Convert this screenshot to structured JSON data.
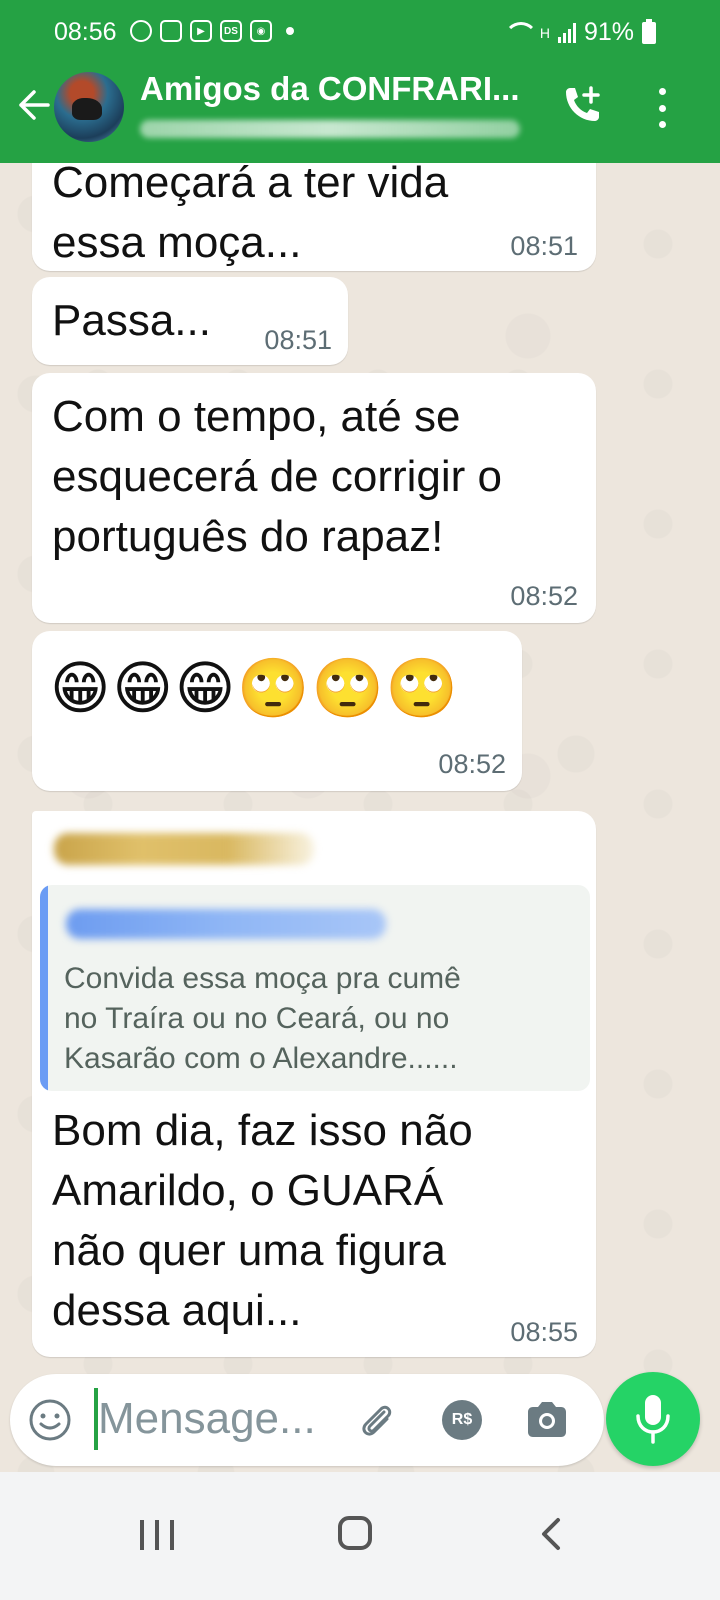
{
  "status_bar": {
    "time": "08:56",
    "battery": "91%",
    "network_indicator": "H",
    "app_icons": [
      "whatsapp-icon",
      "news-icon",
      "youtube-icon",
      "ds-icon",
      "camera-app-icon"
    ]
  },
  "header": {
    "title": "Amigos da CONFRARI...",
    "subtitle_redacted": true,
    "brand_color": "#25a244"
  },
  "messages": [
    {
      "text": "Começará a ter vida\nessa moça...",
      "time": "08:51"
    },
    {
      "text": "Passa...",
      "time": "08:51"
    },
    {
      "text": "Com o tempo, até se\nesquecerá de corrigir o\nportuguês do rapaz!",
      "time": "08:52"
    },
    {
      "text": "😁😁😁🙄🙄🙄",
      "time": "08:52"
    },
    {
      "sender_redacted": true,
      "quote": {
        "author_redacted": true,
        "text": "Convida essa moça pra cumê\nno Traíra ou no Ceará, ou no\nKasarão com o Alexandre......"
      },
      "text": "Bom dia, faz isso não\nAmarildo, o GUARÁ\nnão quer uma figura\ndessa aqui...",
      "time": "08:55"
    }
  ],
  "composer": {
    "placeholder": "Mensage...",
    "payment_label": "R$"
  }
}
